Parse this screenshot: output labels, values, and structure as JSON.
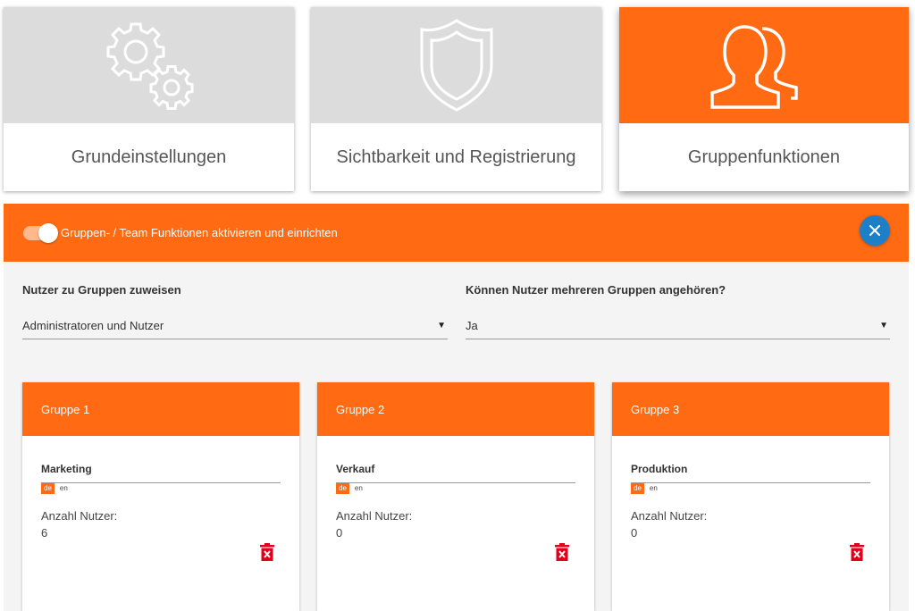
{
  "tiles": [
    {
      "label": "Grundeinstellungen",
      "icon": "gears-icon"
    },
    {
      "label": "Sichtbarkeit und Registrierung",
      "icon": "shield-icon"
    },
    {
      "label": "Gruppenfunktionen",
      "icon": "users-icon"
    }
  ],
  "panel": {
    "toggle_label": "Gruppen- / Team Funktionen aktivieren und einrichten",
    "toggle_on": true,
    "assign": {
      "label": "Nutzer zu Gruppen zuweisen",
      "value": "Administratoren und Nutzer"
    },
    "multi": {
      "label": "Können Nutzer mehreren Gruppen angehören?",
      "value": "Ja"
    },
    "caret": "▼"
  },
  "groups": [
    {
      "title": "Gruppe 1",
      "name": "Marketing",
      "lang_de": "de",
      "lang_en": "en",
      "count_label": "Anzahl Nutzer:",
      "count": "6"
    },
    {
      "title": "Gruppe 2",
      "name": "Verkauf",
      "lang_de": "de",
      "lang_en": "en",
      "count_label": "Anzahl Nutzer:",
      "count": "0"
    },
    {
      "title": "Gruppe 3",
      "name": "Produktion",
      "lang_de": "de",
      "lang_en": "en",
      "count_label": "Anzahl Nutzer:",
      "count": "0"
    }
  ],
  "colors": {
    "accent": "#ff6a13",
    "close": "#1e7fc9",
    "trash": "#e0001b",
    "tile_inactive": "#dcdcdc"
  }
}
